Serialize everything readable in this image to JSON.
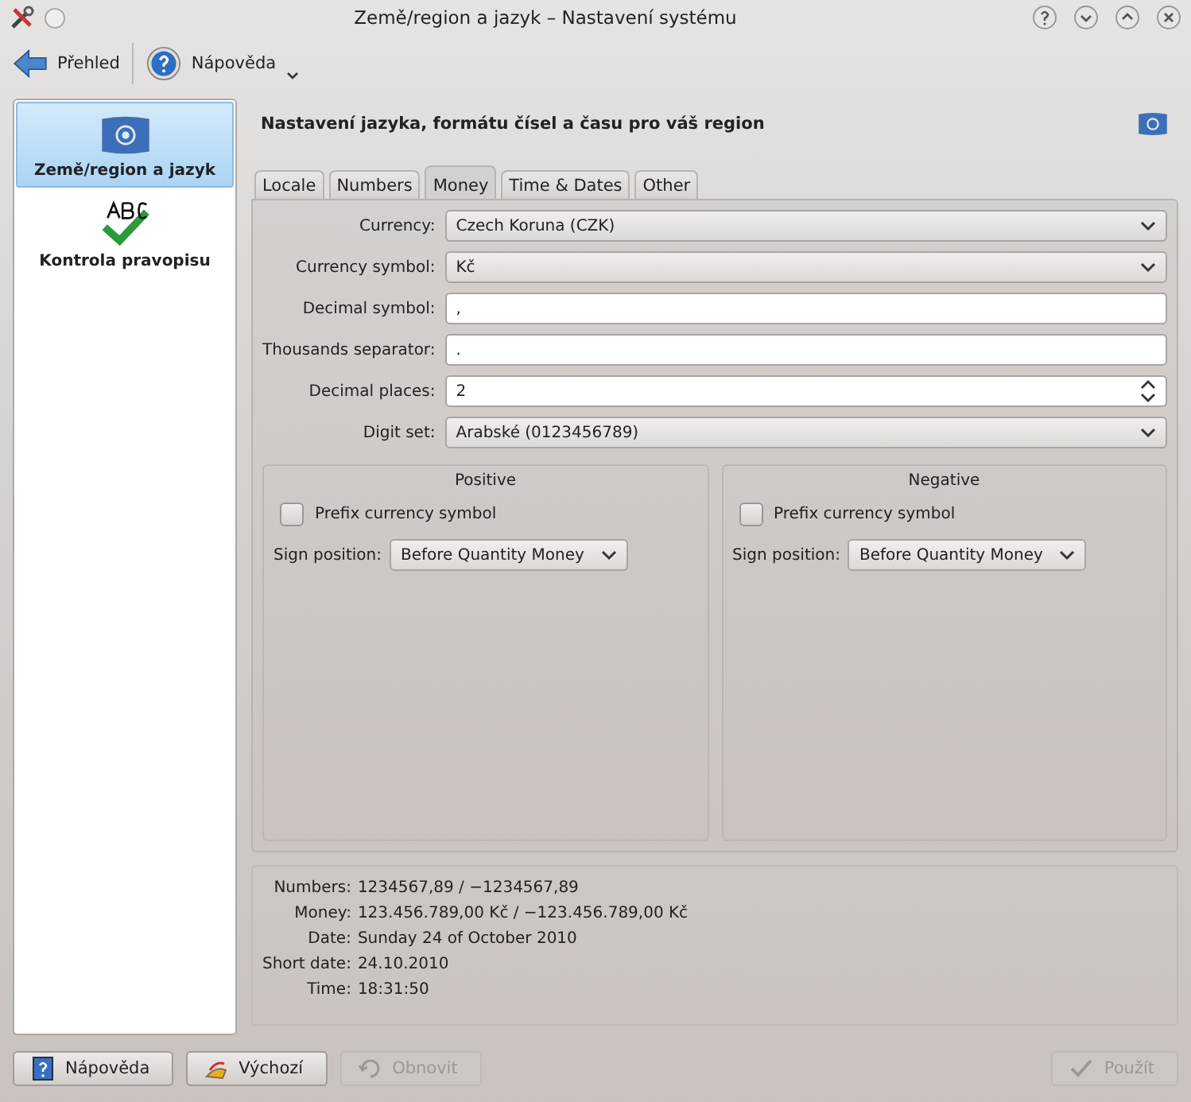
{
  "window": {
    "title": "Země/region a jazyk – Nastavení systému"
  },
  "toolbar": [
    {
      "label": "Přehled",
      "kind": "back"
    },
    {
      "label": "Nápověda",
      "kind": "help"
    }
  ],
  "sidebar": {
    "items": [
      {
        "label": "Země/region a jazyk",
        "kind": "flag",
        "selected": true
      },
      {
        "label": "Kontrola pravopisu",
        "kind": "spell",
        "selected": false
      }
    ]
  },
  "header": "Nastavení jazyka, formátu čísel a času pro váš region",
  "tabs": [
    {
      "label": "Locale",
      "selected": false
    },
    {
      "label": "Numbers",
      "selected": false
    },
    {
      "label": "Money",
      "selected": true
    },
    {
      "label": "Time & Dates",
      "selected": false
    },
    {
      "label": "Other",
      "selected": false
    }
  ],
  "fields": [
    {
      "label": "Currency:",
      "value": "Czech Koruna (CZK)",
      "kind": "combo"
    },
    {
      "label": "Currency symbol:",
      "value": "Kč",
      "kind": "combo"
    },
    {
      "label": "Decimal symbol:",
      "value": ",",
      "kind": "text"
    },
    {
      "label": "Thousands separator:",
      "value": ".",
      "kind": "text"
    },
    {
      "label": "Decimal places:",
      "value": "2",
      "kind": "spin"
    },
    {
      "label": "Digit set:",
      "value": "Arabské (0123456789)",
      "kind": "combo"
    }
  ],
  "groups": [
    {
      "title": "Positive",
      "checkbox": {
        "label": "Prefix currency symbol",
        "checked": false
      },
      "sign_label": "Sign position:",
      "sign_value": "Before Quantity Money"
    },
    {
      "title": "Negative",
      "checkbox": {
        "label": "Prefix currency symbol",
        "checked": false
      },
      "sign_label": "Sign position:",
      "sign_value": "Before Quantity Money"
    }
  ],
  "preview": [
    {
      "label": "Numbers:",
      "value": "1234567,89 / −1234567,89"
    },
    {
      "label": "Money:",
      "value": "123.456.789,00 Kč / −123.456.789,00 Kč"
    },
    {
      "label": "Date:",
      "value": "Sunday 24 of October 2010"
    },
    {
      "label": "Short date:",
      "value": "24.10.2010"
    },
    {
      "label": "Time:",
      "value": "18:31:50"
    }
  ],
  "buttons": [
    {
      "label": "Nápověda",
      "kind": "help",
      "disabled": false
    },
    {
      "label": "Výchozí",
      "kind": "defaults",
      "disabled": false
    },
    {
      "label": "Obnovit",
      "kind": "reset",
      "disabled": true
    },
    {
      "label": "Použít",
      "kind": "apply",
      "disabled": true
    }
  ]
}
